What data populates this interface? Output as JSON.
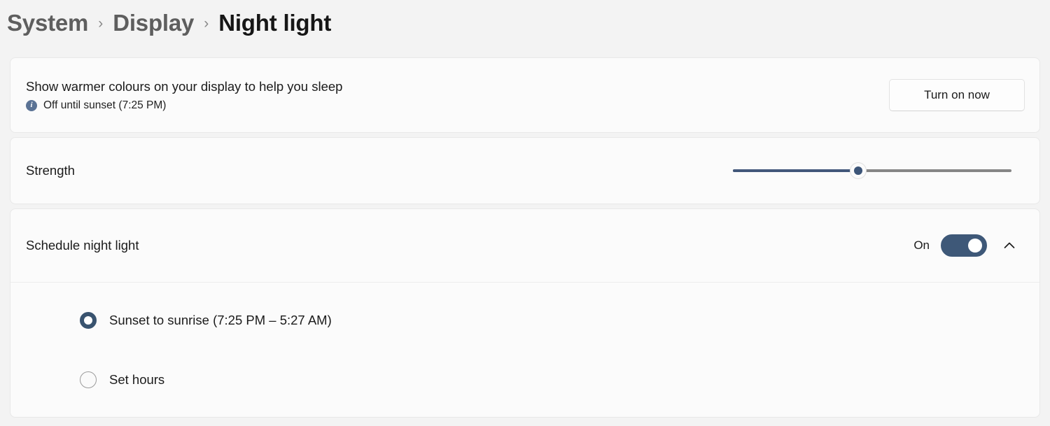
{
  "breadcrumb": {
    "items": [
      {
        "label": "System",
        "current": false
      },
      {
        "label": "Display",
        "current": false
      },
      {
        "label": "Night light",
        "current": true
      }
    ],
    "separator": "›"
  },
  "night_light_card": {
    "title": "Show warmer colours on your display to help you sleep",
    "status_icon": "info-icon",
    "status_text": "Off until sunset (7:25 PM)",
    "button_label": "Turn on now"
  },
  "strength_card": {
    "label": "Strength",
    "slider": {
      "value": 45,
      "min": 0,
      "max": 100,
      "fill_color": "#42577a",
      "track_color": "#868686",
      "thumb_color": "#3c5578"
    }
  },
  "schedule_card": {
    "label": "Schedule night light",
    "toggle_state_label": "On",
    "toggle_on": true,
    "toggle_color": "#3e5878",
    "expand_icon": "chevron-up-icon",
    "options": [
      {
        "label": "Sunset to sunrise (7:25 PM – 5:27 AM)",
        "selected": true
      },
      {
        "label": "Set hours",
        "selected": false
      }
    ]
  }
}
